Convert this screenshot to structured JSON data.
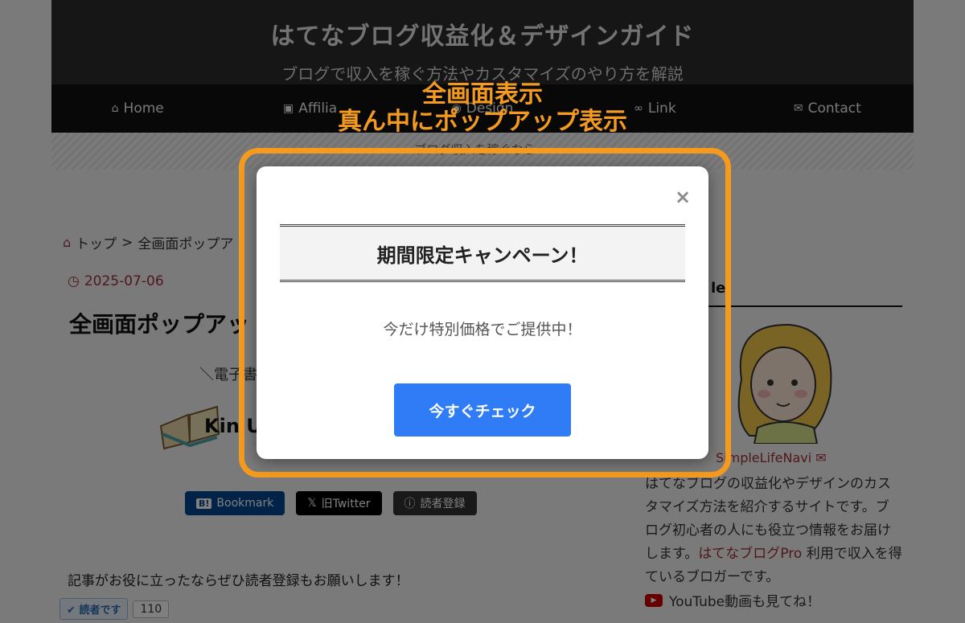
{
  "header": {
    "site_title": "はてなブログ収益化＆デザインガイド",
    "site_description": "ブログで収入を稼ぐ方法やカスタマイズのやり方を解説"
  },
  "nav": [
    {
      "label": "Home",
      "icon": "home-icon"
    },
    {
      "label": "Affilia",
      "icon": "pro-icon"
    },
    {
      "label": "Design",
      "icon": "palette-icon"
    },
    {
      "label": "Link",
      "icon": "link-icon"
    },
    {
      "label": "Contact",
      "icon": "mail-icon"
    }
  ],
  "notice": {
    "text": "ブログ収入を稼ぐなら ... "
  },
  "breadcrumb": {
    "home": "トップ",
    "separator": ">",
    "current": "全画面ポップア"
  },
  "post": {
    "date": "2025-07-06",
    "title": "全画面ポップアッ",
    "ebook_intro": "＼電子書",
    "ebook_title": "Kin U"
  },
  "share": {
    "hatena": "Bookmark",
    "x": "旧Twitter",
    "reader": "読者登録"
  },
  "subscribe": {
    "text": "記事がお役に立ったならぜひ読者登録もお願いします！",
    "button": "読者です",
    "count": "110"
  },
  "sidebar": {
    "heading": "le",
    "profile_name": "SimpleLifeNavi",
    "bio_before": "はてなブログの収益化やデザインのカスタマイズ方法を紹介するサイトです。ブログ初心者の人にも役立つ情報をお届けします。",
    "bio_accent": "はてなブログPro",
    "bio_after": " 利用で収入を得ているブロガーです。",
    "youtube": "YouTube動画も見てね！"
  },
  "annotation": {
    "line1": "全画面表示",
    "line2": "真ん中にポップアップ表示",
    "color": "#f39a1f"
  },
  "modal": {
    "close": "×",
    "heading": "期間限定キャンペーン！",
    "body": "今だけ特別価格でご提供中！",
    "cta": "今すぐチェック",
    "cta_color": "#2f7cf6"
  }
}
